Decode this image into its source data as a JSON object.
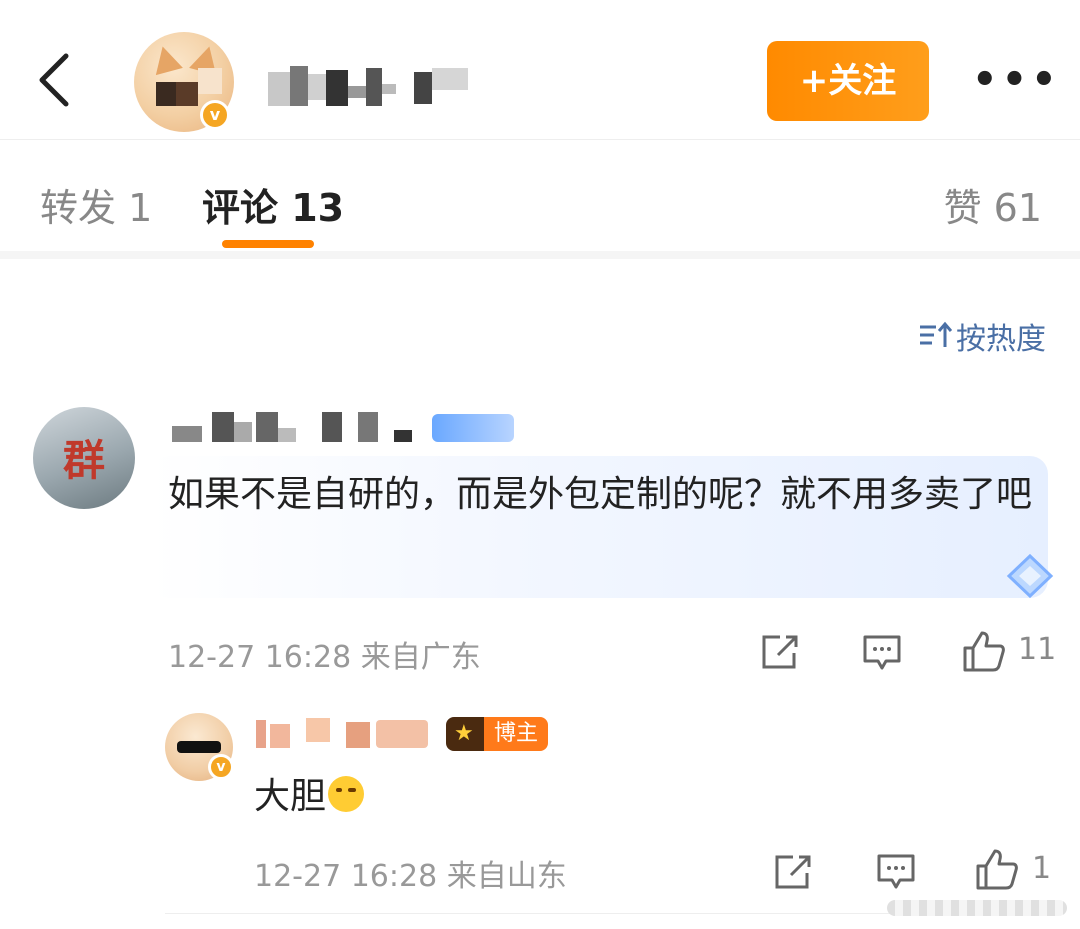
{
  "header": {
    "back_icon": "chevron-left-icon",
    "follow_label": "+关注",
    "more_label": "•••"
  },
  "tabs": {
    "repost": "转发 1",
    "comments": "评论 13",
    "likes": "赞 61"
  },
  "sort": {
    "icon": "sort-icon",
    "label": "按热度"
  },
  "comments": [
    {
      "text": "如果不是自研的，而是外包定制的呢？就不用多卖了吧",
      "meta": "12-27 16:28 来自广东",
      "like_count": "11",
      "replies": [
        {
          "badge": "博主",
          "text": "大胆",
          "meta": "12-27 16:28 来自山东",
          "like_count": "1"
        }
      ]
    }
  ],
  "colors": {
    "accent": "#ff8200",
    "follow_button": "#ff9000",
    "link_blue": "#4a6fa5",
    "verified": "#f5a623"
  }
}
